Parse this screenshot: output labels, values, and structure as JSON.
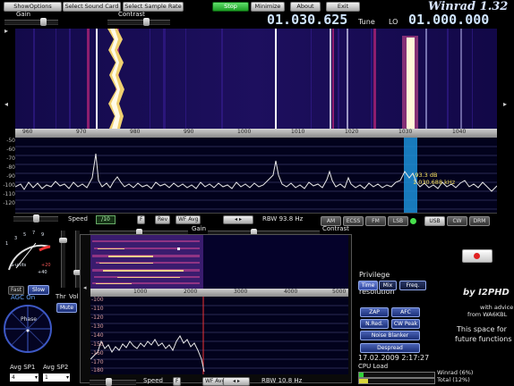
{
  "toolbar": {
    "show_options": "ShowOptions",
    "select_sound_card": "Select Sound Card",
    "select_sample_rate": "Select Sample Rate",
    "stop": "Stop",
    "minimize": "Minimize",
    "about": "About",
    "exit": "Exit"
  },
  "title": "Winrad 1.32",
  "tune_freq": "01.030.625",
  "tune_label": "Tune",
  "lo_label": "LO",
  "lo_freq": "01.000.000",
  "gain_label": "Gain",
  "contrast_label": "Contrast",
  "main_axis_ticks": [
    "960",
    "970",
    "980",
    "990",
    "1000",
    "1010",
    "1020",
    "1030",
    "1040"
  ],
  "spectrum_y_ticks": [
    "-50",
    "-60",
    "-70",
    "-80",
    "-90",
    "-100",
    "-110",
    "-120"
  ],
  "marker": {
    "level": "-93.3 dB",
    "freq": "1.030.688 kHz"
  },
  "spectrum_controls": {
    "speed_label": "Speed",
    "speed_value": "/10",
    "f_btn": "F",
    "rev_btn": "Rev",
    "wf_avg_btn": "WF Avg",
    "rbw": "RBW 93.8 Hz"
  },
  "modes": [
    {
      "label": "AM",
      "on": false
    },
    {
      "label": "ECSS",
      "on": false
    },
    {
      "label": "FM",
      "on": false
    },
    {
      "label": "LSB",
      "on": false
    },
    {
      "label": "USB",
      "on": true
    },
    {
      "label": "CW",
      "on": false
    },
    {
      "label": "DRM",
      "on": false
    }
  ],
  "smeter": {
    "scale": [
      "1",
      "3",
      "5",
      "7",
      "9",
      "+20",
      "+40"
    ],
    "label": "S-units"
  },
  "agc": {
    "fast": "Fast",
    "slow": "Slow",
    "status": "AGC On"
  },
  "vol": {
    "thr": "Thr",
    "vol": "Vol",
    "mute": "Mute"
  },
  "phase_label": "Phase",
  "avg": {
    "sp1_label": "Avg SP1",
    "sp2_label": "Avg SP2",
    "sp1_value": "4",
    "sp2_value": "1"
  },
  "audio": {
    "gain_label": "Gain",
    "contrast_label": "Contrast",
    "axis_ticks": [
      "1000",
      "2000",
      "3000",
      "4000",
      "5000"
    ],
    "y_ticks": [
      "-100",
      "-110",
      "-120",
      "-130",
      "-140",
      "-150",
      "-160",
      "-170",
      "-180"
    ],
    "speed_label": "Speed",
    "f_btn": "F",
    "wf_avg_btn": "WF Avg",
    "rbw": "RBW 10.8 Hz"
  },
  "privilege": {
    "title": "Privilege",
    "resolution": "resolution",
    "time": "Time",
    "mix": "Mix",
    "freq": "Freq."
  },
  "dsp": {
    "zap": "ZAP",
    "afc": "AFC",
    "nred": "N.Red.",
    "cwpeak": "CW Peak",
    "noise_blanker": "Noise Blanker",
    "despread": "Despread"
  },
  "datetime": "17.02.2009 2:17:27",
  "cpu_label": "CPU Load",
  "cpu": {
    "winrad": "Winrad (6%)",
    "total": "Total  (12%)"
  },
  "credits": {
    "by": "by I2PHD",
    "advice1": "with advice",
    "advice2": "from WA6KBL",
    "space1": "This space for",
    "space2": "future functions"
  },
  "colors": {
    "accent": "#4a63b5",
    "green": "#1b9d23",
    "trace": "#e8e8e8",
    "highlight": "#1c8fd8"
  }
}
